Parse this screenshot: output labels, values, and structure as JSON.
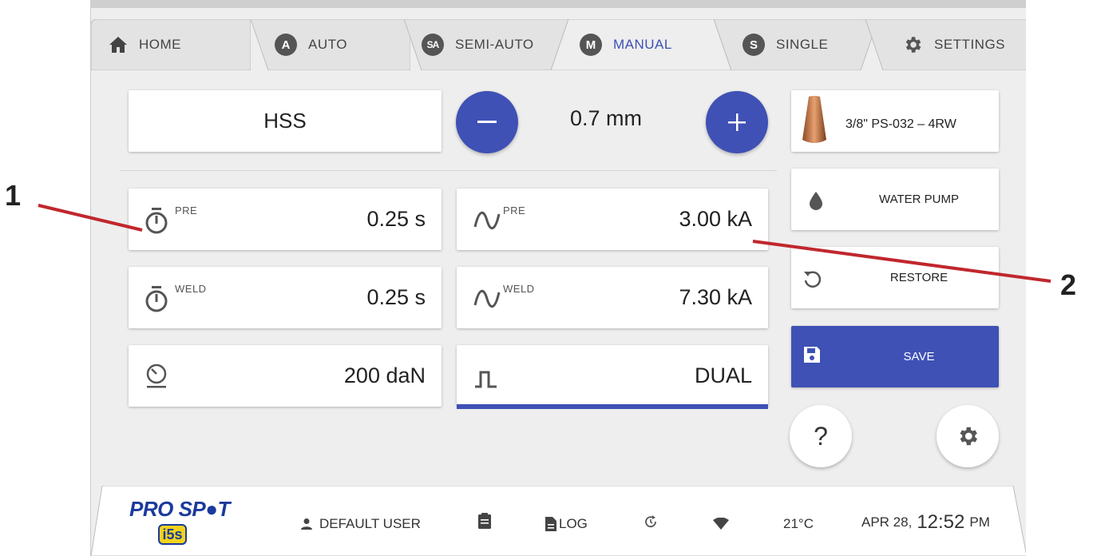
{
  "tabs": [
    {
      "label": "HOME",
      "badge": "",
      "icon": "home-icon"
    },
    {
      "label": "AUTO",
      "badge": "A",
      "icon": "auto-badge"
    },
    {
      "label": "SEMI-AUTO",
      "badge": "SA",
      "icon": "semi-auto-badge"
    },
    {
      "label": "MANUAL",
      "badge": "M",
      "icon": "manual-badge",
      "active": true
    },
    {
      "label": "SINGLE",
      "badge": "S",
      "icon": "single-badge"
    },
    {
      "label": "SETTINGS",
      "badge": "",
      "icon": "gear-icon"
    }
  ],
  "material": "HSS",
  "thickness": "0.7 mm",
  "electrode": "3/8\" PS-032 – 4RW",
  "params": {
    "pre_time": {
      "sup": "PRE",
      "value": "0.25 s"
    },
    "weld_time": {
      "sup": "WELD",
      "value": "0.25 s"
    },
    "pre_current": {
      "sup": "PRE",
      "value": "3.00 kA"
    },
    "weld_current": {
      "sup": "WELD",
      "value": "7.30 kA"
    },
    "force": {
      "value": "200 daN"
    },
    "pulse_mode": {
      "value": "DUAL"
    }
  },
  "side": {
    "water_pump": "WATER PUMP",
    "restore": "RESTORE",
    "save": "SAVE",
    "help": "?"
  },
  "status": {
    "logo": "PRO SP●T",
    "logo_sub": "i5s",
    "user": "DEFAULT USER",
    "log": "LOG",
    "temperature": "21°C",
    "date": "APR 28,",
    "time": "12:52",
    "ampm": "PM"
  },
  "callouts": {
    "one": "1",
    "two": "2"
  },
  "colors": {
    "accent": "#3f51b5",
    "callout_line": "#c0272d",
    "logo_blue": "#1a3a9c",
    "logo_yellow": "#f2d31b"
  }
}
